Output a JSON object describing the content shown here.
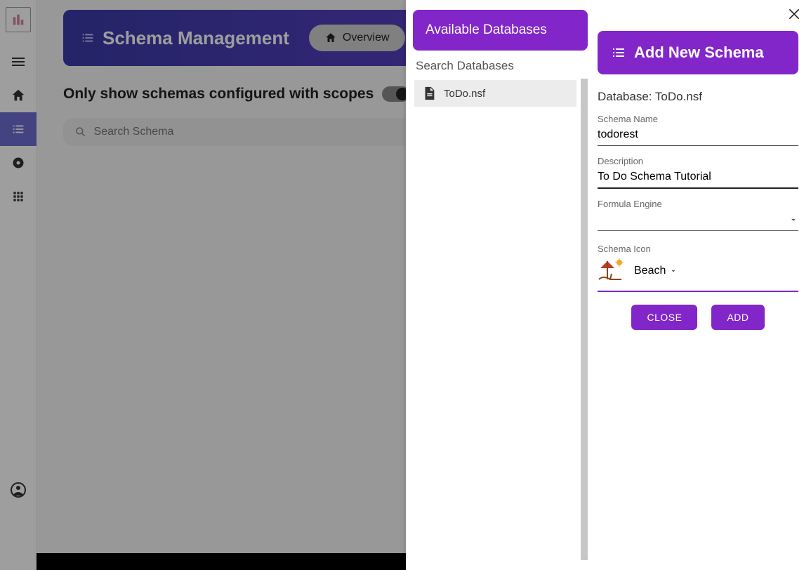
{
  "sidenav": {
    "items": [
      "menu",
      "home",
      "list",
      "disc",
      "apps"
    ],
    "active_index": 2
  },
  "header": {
    "title": "Schema Management",
    "overview_label": "Overview"
  },
  "toggle_label": "Only show schemas configured with scopes",
  "search_placeholder": "Search Schema",
  "panel": {
    "available_title": "Available Databases",
    "search_db_label": "Search Databases",
    "databases": [
      {
        "name": "ToDo.nsf"
      }
    ],
    "add_title": "Add New Schema",
    "db_label_prefix": "Database: ",
    "selected_db": "ToDo.nsf",
    "schema_name_label": "Schema Name",
    "schema_name_value": "todorest",
    "description_label": "Description",
    "description_value": "To Do Schema Tutorial",
    "formula_label": "Formula Engine",
    "formula_value": "",
    "schema_icon_label": "Schema Icon",
    "schema_icon_value": "Beach",
    "close_label": "CLOSE",
    "add_label": "ADD"
  }
}
